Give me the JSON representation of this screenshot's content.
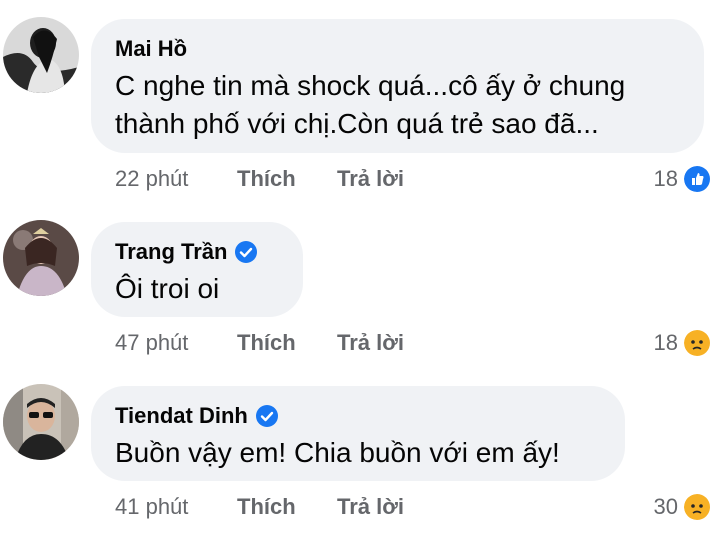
{
  "comments": [
    {
      "author": "Mai Hồ",
      "verified": false,
      "text_lines": [
        "C nghe tin mà shock quá...cô ấy ở chung",
        "thành phố với chị.Còn quá trẻ sao đã..."
      ],
      "time": "22 phút",
      "like_label": "Thích",
      "reply_label": "Trả lời",
      "reaction_count": "18",
      "reaction_icon": "like-icon"
    },
    {
      "author": "Trang Trần",
      "verified": true,
      "text_lines": [
        "Ôi troi oi"
      ],
      "time": "47 phút",
      "like_label": "Thích",
      "reply_label": "Trả lời",
      "reaction_count": "18",
      "reaction_icon": "sad-icon"
    },
    {
      "author": "Tiendat Dinh",
      "verified": true,
      "text_lines": [
        "Buồn vậy em! Chia buồn với em ấy!"
      ],
      "time": "41 phút",
      "like_label": "Thích",
      "reply_label": "Trả lời",
      "reaction_count": "30",
      "reaction_icon": "sad-icon"
    }
  ],
  "colors": {
    "bubble": "#f0f2f5",
    "meta": "#65676b",
    "verified": "#1877f2",
    "like": "#1877f2",
    "sad": "#f7b125"
  }
}
